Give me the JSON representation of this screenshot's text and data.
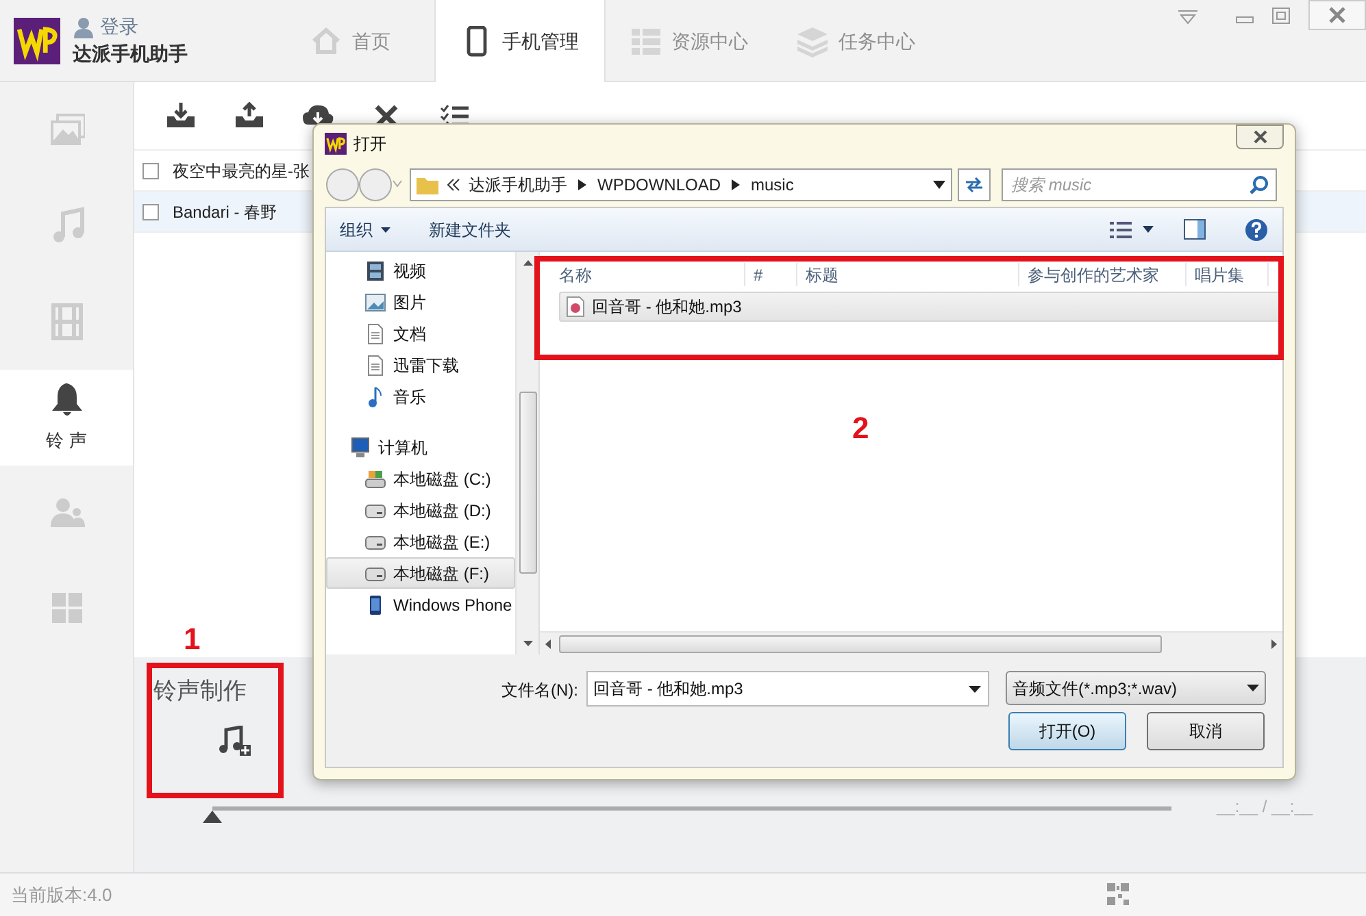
{
  "app": {
    "name": "达派手机助手",
    "login": "登录"
  },
  "tabs": [
    {
      "label": "首页",
      "selected": false,
      "kind": "home"
    },
    {
      "label": "手机管理",
      "selected": true,
      "kind": "phone"
    },
    {
      "label": "资源中心",
      "selected": false,
      "kind": "grid"
    },
    {
      "label": "任务中心",
      "selected": false,
      "kind": "layers"
    }
  ],
  "sidebar": {
    "items": [
      {
        "kind": "photos",
        "selected": false
      },
      {
        "kind": "music",
        "selected": false
      },
      {
        "kind": "video",
        "selected": false
      },
      {
        "kind": "ringtone",
        "selected": true,
        "label": "铃 声"
      },
      {
        "kind": "contacts",
        "selected": false
      },
      {
        "kind": "apps",
        "selected": false
      }
    ]
  },
  "songs": [
    {
      "title": "夜空中最亮的星-张",
      "checked": false,
      "selected": false
    },
    {
      "title": "Bandari - 春野",
      "checked": false,
      "selected": true
    }
  ],
  "ringtone_maker": {
    "title": "铃声制作",
    "level": 0,
    "time": "__:__ / __:__"
  },
  "annotations": [
    {
      "label": "1"
    },
    {
      "label": "2"
    }
  ],
  "status_bar": {
    "version": "当前版本:4.0"
  },
  "dialog": {
    "title": "打开",
    "breadcrumb": [
      "达派手机助手",
      "WPDOWNLOAD",
      "music"
    ],
    "search_placeholder": "搜索 music",
    "toolbar": [
      "组织",
      "新建文件夹"
    ],
    "nav": [
      {
        "label": "视频",
        "kind": "video"
      },
      {
        "label": "图片",
        "kind": "image"
      },
      {
        "label": "文档",
        "kind": "doc"
      },
      {
        "label": "迅雷下载",
        "kind": "doc"
      },
      {
        "label": "音乐",
        "kind": "music"
      },
      {
        "label": "计算机",
        "kind": "computer",
        "children": [
          {
            "label": "本地磁盘 (C:)",
            "kind": "system-drive",
            "selected": false
          },
          {
            "label": "本地磁盘 (D:)",
            "kind": "drive",
            "selected": false
          },
          {
            "label": "本地磁盘 (E:)",
            "kind": "drive",
            "selected": false
          },
          {
            "label": "本地磁盘 (F:)",
            "kind": "drive",
            "selected": true
          },
          {
            "label": "Windows Phone",
            "kind": "phone",
            "selected": false
          }
        ]
      }
    ],
    "columns": [
      "名称",
      "#",
      "标题",
      "参与创作的艺术家",
      "唱片集"
    ],
    "files": [
      {
        "name": "回音哥 - 他和她.mp3",
        "selected": true
      }
    ],
    "filename_label": "文件名(N):",
    "filename": "回音哥 - 他和她.mp3",
    "filter": "音频文件(*.mp3;*.wav)",
    "buttons": [
      "打开(O)",
      "取消"
    ]
  }
}
